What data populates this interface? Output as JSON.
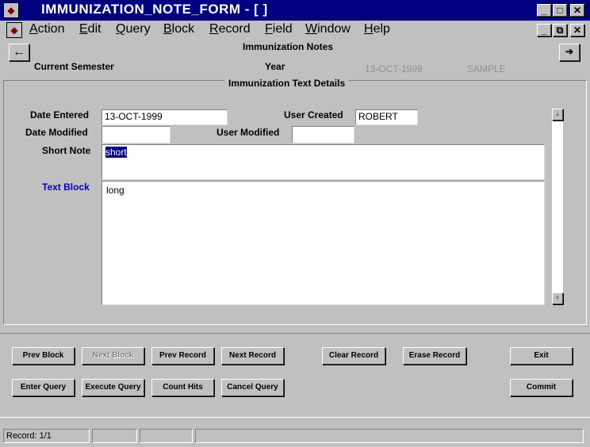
{
  "window": {
    "title": "IMMUNIZATION_NOTE_FORM - [ ]",
    "controls": [
      "_",
      "□",
      "X"
    ],
    "inner_controls": [
      "_",
      "⧉",
      "X"
    ]
  },
  "menu": [
    "Action",
    "Edit",
    "Query",
    "Block",
    "Record",
    "Field",
    "Window",
    "Help"
  ],
  "header": {
    "title": "Immunization Notes",
    "current_semester_label": "Current Semester",
    "year_label": "Year",
    "date_value": "13-OCT-1999",
    "sample_value": "SAMPLE",
    "section_title": "Immunization Text Details"
  },
  "form": {
    "date_entered_label": "Date Entered",
    "date_entered_value": "13-OCT-1999",
    "user_created_label": "User Created",
    "user_created_value": "ROBERT",
    "date_modified_label": "Date Modified",
    "date_modified_value": "",
    "user_modified_label": "User Modified",
    "user_modified_value": "",
    "short_note_label": "Short Note",
    "short_note_value": "short",
    "text_block_label": "Text Block",
    "text_block_value": "long"
  },
  "buttons": {
    "prev_block": "Prev Block",
    "next_block": "Next Block",
    "prev_record": "Prev Record",
    "next_record": "Next Record",
    "clear_record": "Clear Record",
    "erase_record": "Erase Record",
    "exit": "Exit",
    "enter_query": "Enter Query",
    "execute_query": "Execute Query",
    "count_hits": "Count Hits",
    "cancel_query": "Cancel Query",
    "commit": "Commit"
  },
  "status": {
    "record": "Record: 1/1"
  },
  "colors": {
    "titlebar": "#000080",
    "label_blue": "#0000c0",
    "selection": "#000080"
  }
}
